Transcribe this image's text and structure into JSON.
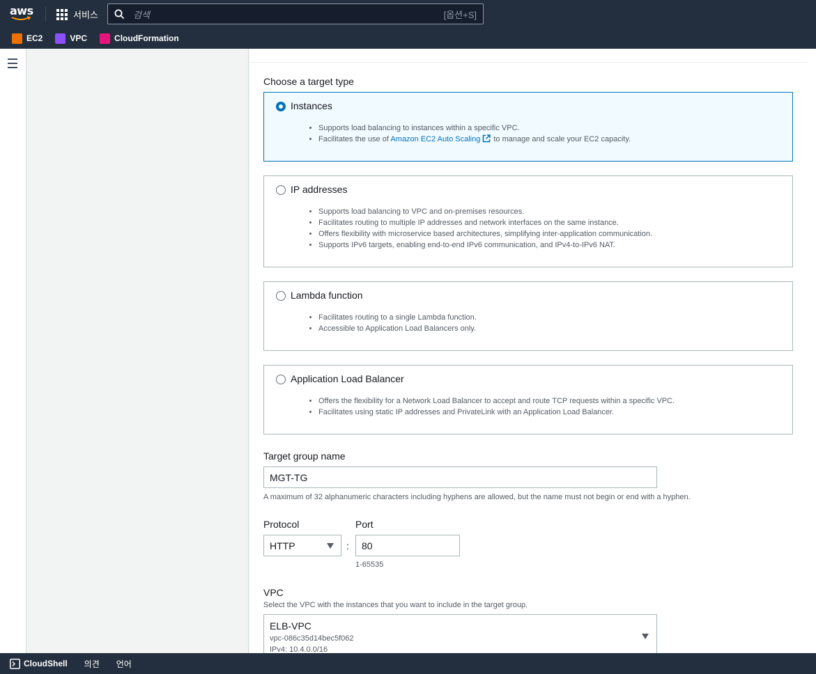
{
  "topnav": {
    "logo_text": "aws",
    "services_label": "서비스",
    "search_placeholder": "검색",
    "search_shortcut": "[옵션+S]"
  },
  "favorites": [
    {
      "label": "EC2",
      "color": "#ed7100"
    },
    {
      "label": "VPC",
      "color": "#8c4fff"
    },
    {
      "label": "CloudFormation",
      "color": "#e7157b"
    }
  ],
  "target_type": {
    "heading": "Choose a target type",
    "options": [
      {
        "title": "Instances",
        "selected": true,
        "bullets": [
          "Supports load balancing to instances within a specific VPC.",
          "Facilitates the use of"
        ],
        "link_text": "Amazon EC2 Auto Scaling",
        "link_suffix": "to manage and scale your EC2 capacity."
      },
      {
        "title": "IP addresses",
        "selected": false,
        "bullets": [
          "Supports load balancing to VPC and on-premises resources.",
          "Facilitates routing to multiple IP addresses and network interfaces on the same instance.",
          "Offers flexibility with microservice based architectures, simplifying inter-application communication.",
          "Supports IPv6 targets, enabling end-to-end IPv6 communication, and IPv4-to-IPv6 NAT."
        ]
      },
      {
        "title": "Lambda function",
        "selected": false,
        "bullets": [
          "Facilitates routing to a single Lambda function.",
          "Accessible to Application Load Balancers only."
        ]
      },
      {
        "title": "Application Load Balancer",
        "selected": false,
        "bullets": [
          "Offers the flexibility for a Network Load Balancer to accept and route TCP requests within a specific VPC.",
          "Facilitates using static IP addresses and PrivateLink with an Application Load Balancer."
        ]
      }
    ]
  },
  "target_group_name": {
    "label": "Target group name",
    "value": "MGT-TG",
    "constraint": "A maximum of 32 alphanumeric characters including hyphens are allowed, but the name must not begin or end with a hyphen."
  },
  "protocol": {
    "label": "Protocol",
    "value": "HTTP",
    "separator": ":"
  },
  "port": {
    "label": "Port",
    "value": "80",
    "hint": "1-65535"
  },
  "vpc": {
    "label": "VPC",
    "description": "Select the VPC with the instances that you want to include in the target group.",
    "name": "ELB-VPC",
    "id": "vpc-086c35d14bec5f062",
    "cidr": "IPv4: 10.4.0.0/16"
  },
  "bottombar": {
    "cloudshell": "CloudShell",
    "feedback": "의견",
    "language": "언어"
  }
}
